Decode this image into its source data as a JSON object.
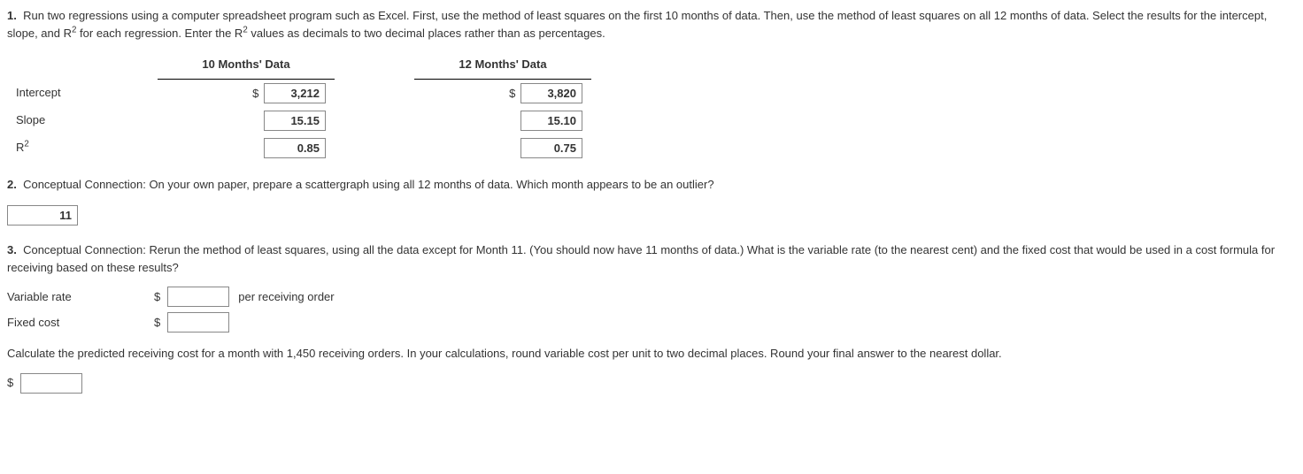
{
  "q1": {
    "number": "1.",
    "text": "Run two regressions using a computer spreadsheet program such as Excel. First, use the method of least squares on the first 10 months of data. Then, use the method of least squares on all 12 months of data. Select the results for the intercept, slope, and R",
    "text_sup": "2",
    "text2": " for each regression. Enter the R",
    "text2_sup": "2",
    "text3": " values as decimals to two decimal places rather than as percentages.",
    "headers": {
      "col1": "10 Months' Data",
      "col2": "12 Months' Data"
    },
    "rows": {
      "intercept": {
        "label": "Intercept",
        "v1": "3,212",
        "v2": "3,820",
        "currency": "$"
      },
      "slope": {
        "label": "Slope",
        "v1": "15.15",
        "v2": "15.10"
      },
      "r2": {
        "label_pre": "R",
        "label_sup": "2",
        "v1": "0.85",
        "v2": "0.75"
      }
    }
  },
  "q2": {
    "number": "2.",
    "text": "Conceptual Connection: On your own paper, prepare a scattergraph using all 12 months of data. Which month appears to be an outlier?",
    "answer": "11"
  },
  "q3": {
    "number": "3.",
    "text": "Conceptual Connection: Rerun the method of least squares, using all the data except for Month 11. (You should now have 11 months of data.) What is the variable rate (to the nearest cent) and the fixed cost that would be used in a cost formula for receiving based on these results?",
    "variable_rate": {
      "label": "Variable rate",
      "currency": "$",
      "value": "",
      "unit": "per receiving order"
    },
    "fixed_cost": {
      "label": "Fixed cost",
      "currency": "$",
      "value": ""
    },
    "predict_text": "Calculate the predicted receiving cost for a month with 1,450 receiving orders. In your calculations, round variable cost per unit to two decimal places. Round your final answer to the nearest dollar.",
    "predict_currency": "$",
    "predict_value": ""
  }
}
